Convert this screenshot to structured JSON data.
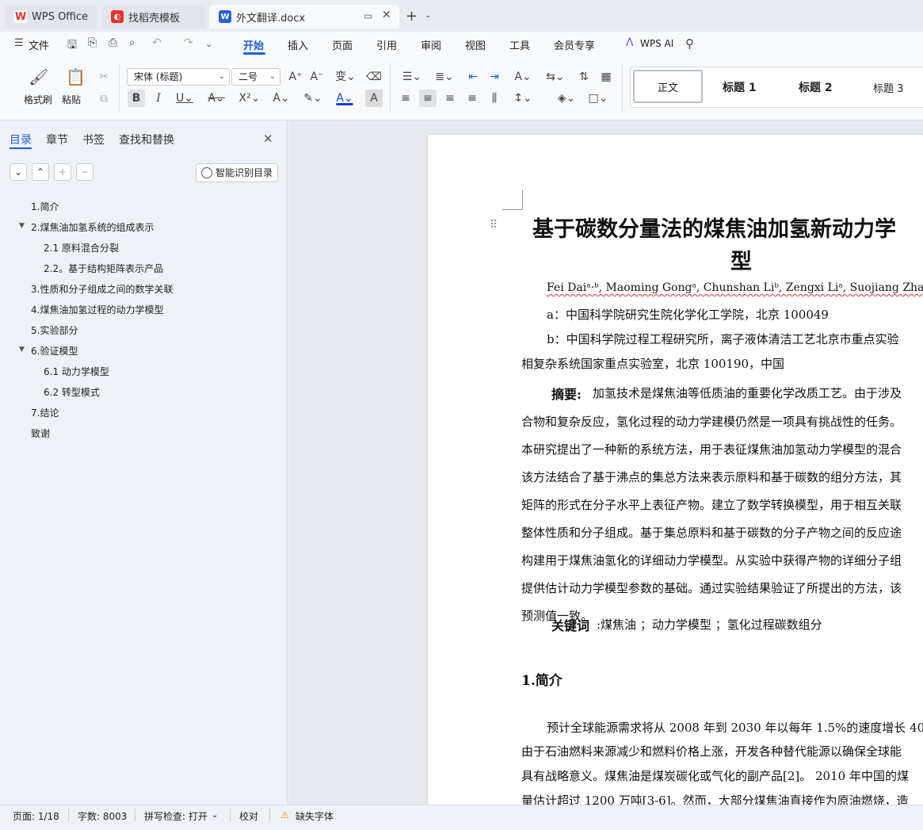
{
  "tabs": {
    "wps": "WPS Office",
    "templates": "找稻壳模板",
    "doc": "外文翻译.docx",
    "new_tab": "+"
  },
  "menu": {
    "file": "文件",
    "items": [
      "开始",
      "插入",
      "页面",
      "引用",
      "审阅",
      "视图",
      "工具",
      "会员专享"
    ],
    "wps_ai": "WPS AI"
  },
  "ribbon": {
    "format_painter": "格式刷",
    "paste": "粘贴",
    "font_name": "宋体 (标题)",
    "font_size": "二号",
    "styles": [
      "正文",
      "标题 1",
      "标题 2",
      "标题 3"
    ]
  },
  "nav": {
    "tabs": [
      "目录",
      "章节",
      "书签",
      "查找和替换"
    ],
    "smart_toc": "智能识别目录",
    "toc": [
      {
        "label": "1.简介",
        "level": 1,
        "expandable": false
      },
      {
        "label": "2.煤焦油加氢系统的组成表示",
        "level": 1,
        "expandable": true
      },
      {
        "label": "2.1 原料混合分裂",
        "level": 2,
        "expandable": false
      },
      {
        "label": "2.2。基于结构矩阵表示产品",
        "level": 2,
        "expandable": false
      },
      {
        "label": "3.性质和分子组成之间的数学关联",
        "level": 1,
        "expandable": false
      },
      {
        "label": "4.煤焦油加氢过程的动力学模型",
        "level": 1,
        "expandable": false
      },
      {
        "label": "5.实验部分",
        "level": 1,
        "expandable": false
      },
      {
        "label": "6.验证模型",
        "level": 1,
        "expandable": true
      },
      {
        "label": "6.1 动力学模型",
        "level": 2,
        "expandable": false
      },
      {
        "label": "6.2  转型模式",
        "level": 2,
        "expandable": false
      },
      {
        "label": "7.结论",
        "level": 1,
        "expandable": false
      },
      {
        "label": "致谢",
        "level": 1,
        "expandable": false
      }
    ]
  },
  "doc": {
    "title_line1": "基于碳数分量法的煤焦油加氢新动力学",
    "title_line2": "型",
    "authors": "Fei Daiᵃ·ᵇ, Maoming Gongᵃ, Chunshan Liᵇ, Zengxi Liᵃ, Suojiang Zhangᵇ,",
    "affil_a": "a：中国科学院研究生院化学化工学院，北京 100049",
    "affil_b1": "b：中国科学院过程工程研究所，离子液体清洁工艺北京市重点实验",
    "affil_b2": "相复杂系统国家重点实验室，北京 100190，中国",
    "abstract_label": "摘要:",
    "abstract_lines": [
      "加氢技术是煤焦油等低质油的重要化学改质工艺。由于涉及",
      "合物和复杂反应，氢化过程的动力学建模仍然是一项具有挑战性的任务。",
      "本研究提出了一种新的系统方法，用于表征煤焦油加氢动力学模型的混合",
      "该方法结合了基于沸点的集总方法来表示原料和基于碳数的组分方法，其",
      "矩阵的形式在分子水平上表征产物。建立了数学转换模型，用于相互关联",
      "整体性质和分子组成。基于集总原料和基于碳数的分子产物之间的反应途",
      "构建用于煤焦油氢化的详细动力学模型。从实验中获得产物的详细分子组",
      "提供估计动力学模型参数的基础。通过实验结果验证了所提出的方法，该",
      "预测值一致。"
    ],
    "keywords_label": "关键词",
    "keywords": ":煤焦油 ；动力学模型 ；氢化过程碳数组分",
    "section1": "1.简介",
    "intro_lines": [
      "预计全球能源需求将从 2008 年到 2030 年以每年 1.5%的速度增长 40",
      "由于石油燃料来源减少和燃料价格上涨，开发各种替代能源以确保全球能",
      "具有战略意义。煤焦油是煤炭碳化或气化的副产品[2]。 2010 年中国的煤",
      "量估计超过 1200 万吨[3-6]。然而，大部分煤焦油直接作为原油燃烧，造"
    ]
  },
  "status": {
    "page": "页面: 1/18",
    "words": "字数: 8003",
    "spell": "拼写检查: 打开",
    "proof": "校对",
    "missing_font": "缺失字体"
  },
  "colors": {
    "accent": "#1f5fd6",
    "wps_red": "#e8352e",
    "doc_blue": "#2b5fd9"
  }
}
